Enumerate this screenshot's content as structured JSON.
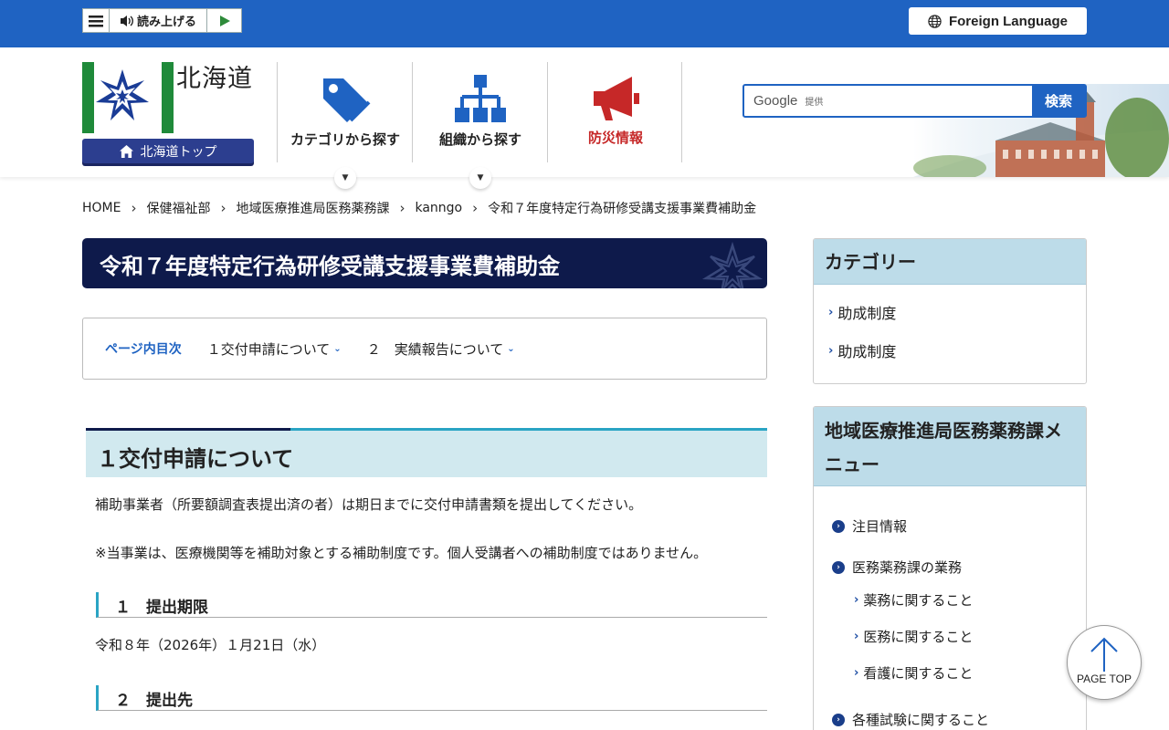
{
  "topbar": {
    "read_aloud_label": "読み上げる",
    "foreign_language_label": "Foreign Language"
  },
  "header": {
    "prefecture_name": "北海道",
    "home_button_label": "北海道トップ",
    "nav": [
      {
        "label": "カテゴリから探す"
      },
      {
        "label": "組織から探す"
      },
      {
        "label": "防災情報"
      }
    ],
    "search": {
      "google_label": "Google",
      "provided_label": "提供",
      "button_label": "検索"
    }
  },
  "breadcrumb": [
    "HOME",
    "保健福祉部",
    "地域医療推進局医務薬務課",
    "kanngo",
    "令和７年度特定行為研修受講支援事業費補助金"
  ],
  "page_title": "令和７年度特定行為研修受講支援事業費補助金",
  "toc": {
    "label": "ページ内目次",
    "links": [
      "１交付申請について",
      "２　実績報告について"
    ]
  },
  "section1": {
    "heading": "１交付申請について",
    "para1": "補助事業者（所要額調査表提出済の者）は期日までに交付申請書類を提出してください。",
    "para2": "※当事業は、医療機関等を補助対象とする補助制度です。個人受講者への補助制度ではありません。",
    "sub1_heading": "１　提出期限",
    "sub1_text": "令和８年（2026年）１月21日（水）",
    "sub2_heading": "２　提出先"
  },
  "sidebar": {
    "category_heading": "カテゴリー",
    "categories": [
      "助成制度",
      "助成制度"
    ],
    "menu_heading": "地域医療推進局医務薬務課メニュー",
    "menu": [
      {
        "label": "注目情報"
      },
      {
        "label": "医務薬務課の業務"
      },
      {
        "label": "薬務に関すること"
      },
      {
        "label": "医務に関すること"
      },
      {
        "label": "看護に関すること"
      },
      {
        "label": "各種試験に関すること"
      }
    ]
  },
  "page_top_label": "PAGE TOP",
  "colors": {
    "topbar_blue": "#1f63c2",
    "title_navy": "#0e1a4b",
    "accent_teal": "#2aa4c4",
    "disaster_red": "#c62828"
  }
}
